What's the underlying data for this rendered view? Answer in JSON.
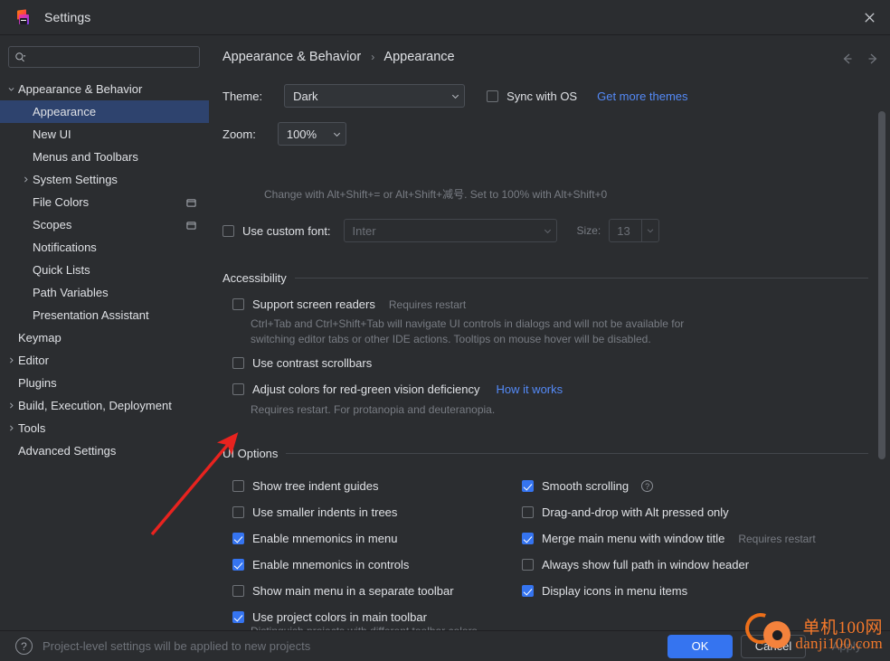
{
  "window": {
    "title": "Settings",
    "logo_icon": "jetbrains-logo-icon",
    "close_icon": "close-icon"
  },
  "sidebar": {
    "search": {
      "placeholder": "",
      "value": "",
      "icon": "search-icon"
    },
    "items": [
      {
        "label": "Appearance & Behavior",
        "level": 0,
        "twisty": "chevron-down-icon",
        "selected": false,
        "right_icon": ""
      },
      {
        "label": "Appearance",
        "level": 1,
        "twisty": "",
        "selected": true,
        "right_icon": ""
      },
      {
        "label": "New UI",
        "level": 1,
        "twisty": "",
        "selected": false,
        "right_icon": ""
      },
      {
        "label": "Menus and Toolbars",
        "level": 1,
        "twisty": "",
        "selected": false,
        "right_icon": ""
      },
      {
        "label": "System Settings",
        "level": 1,
        "twisty": "chevron-right-icon",
        "selected": false,
        "right_icon": ""
      },
      {
        "label": "File Colors",
        "level": 1,
        "twisty": "",
        "selected": false,
        "right_icon": "project-scope-icon"
      },
      {
        "label": "Scopes",
        "level": 1,
        "twisty": "",
        "selected": false,
        "right_icon": "project-scope-icon"
      },
      {
        "label": "Notifications",
        "level": 1,
        "twisty": "",
        "selected": false,
        "right_icon": ""
      },
      {
        "label": "Quick Lists",
        "level": 1,
        "twisty": "",
        "selected": false,
        "right_icon": ""
      },
      {
        "label": "Path Variables",
        "level": 1,
        "twisty": "",
        "selected": false,
        "right_icon": ""
      },
      {
        "label": "Presentation Assistant",
        "level": 1,
        "twisty": "",
        "selected": false,
        "right_icon": ""
      },
      {
        "label": "Keymap",
        "level": 0,
        "twisty": "",
        "selected": false,
        "right_icon": ""
      },
      {
        "label": "Editor",
        "level": 0,
        "twisty": "chevron-right-icon",
        "selected": false,
        "right_icon": ""
      },
      {
        "label": "Plugins",
        "level": 0,
        "twisty": "",
        "selected": false,
        "right_icon": ""
      },
      {
        "label": "Build, Execution, Deployment",
        "level": 0,
        "twisty": "chevron-right-icon",
        "selected": false,
        "right_icon": ""
      },
      {
        "label": "Tools",
        "level": 0,
        "twisty": "chevron-right-icon",
        "selected": false,
        "right_icon": ""
      },
      {
        "label": "Advanced Settings",
        "level": 0,
        "twisty": "",
        "selected": false,
        "right_icon": ""
      }
    ]
  },
  "breadcrumb": {
    "root": "Appearance & Behavior",
    "separator": "›",
    "current": "Appearance"
  },
  "nav": {
    "back_icon": "arrow-left-icon",
    "forward_icon": "arrow-right-icon"
  },
  "appearance": {
    "theme_label": "Theme:",
    "theme_value": "Dark",
    "sync_with_os_label": "Sync with OS",
    "sync_with_os_checked": false,
    "get_more_themes_label": "Get more themes",
    "zoom_label": "Zoom:",
    "zoom_value": "100%",
    "zoom_hint": "Change with Alt+Shift+= or Alt+Shift+减号. Set to 100% with Alt+Shift+0",
    "custom_font_label": "Use custom font:",
    "custom_font_checked": false,
    "custom_font_value": "Inter",
    "size_label": "Size:",
    "size_value": "13"
  },
  "accessibility": {
    "title": "Accessibility",
    "items": [
      {
        "label": "Support screen readers",
        "checked": false,
        "note": "Requires restart",
        "description": "Ctrl+Tab and Ctrl+Shift+Tab will navigate UI controls in dialogs and will not be available for switching editor tabs or other IDE actions. Tooltips on mouse hover will be disabled."
      },
      {
        "label": "Use contrast scrollbars",
        "checked": false,
        "note": "",
        "description": ""
      },
      {
        "label": "Adjust colors for red-green vision deficiency",
        "checked": false,
        "note": "",
        "link": "How it works",
        "description": "Requires restart. For protanopia and deuteranopia."
      }
    ]
  },
  "ui_options": {
    "title": "UI Options",
    "left_column": [
      {
        "label": "Show tree indent guides",
        "checked": false
      },
      {
        "label": "Use smaller indents in trees",
        "checked": false
      },
      {
        "label": "Enable mnemonics in menu",
        "checked": true
      },
      {
        "label": "Enable mnemonics in controls",
        "checked": true
      },
      {
        "label": "Show main menu in a separate toolbar",
        "checked": false
      },
      {
        "label": "Use project colors in main toolbar",
        "checked": true
      }
    ],
    "left_description": "Distinguish projects with different toolbar colors at a glance. Only for new UI.",
    "right_column": [
      {
        "label": "Smooth scrolling",
        "checked": true,
        "note": "",
        "help_icon": "help-circle-icon"
      },
      {
        "label": "Drag-and-drop with Alt pressed only",
        "checked": false,
        "note": ""
      },
      {
        "label": "Merge main menu with window title",
        "checked": true,
        "note": "Requires restart"
      },
      {
        "label": "Always show full path in window header",
        "checked": false,
        "note": ""
      },
      {
        "label": "Display icons in menu items",
        "checked": true,
        "note": ""
      }
    ]
  },
  "footer": {
    "help_icon": "help-circle-icon",
    "note": "Project-level settings will be applied to new projects",
    "ok_label": "OK",
    "cancel_label": "Cancel",
    "apply_label": "Apply"
  },
  "annotation": {
    "arrow_color": "#e8231f",
    "arrow_icon": "red-arrow-pointer"
  },
  "watermark": {
    "line1": "单机100网",
    "line2": "danji100.com",
    "color": "#f4792b",
    "logo_icon": "watermark-ring-icon"
  },
  "colors": {
    "background": "#2b2d30",
    "selection": "#2e436e",
    "accent": "#3574f0",
    "link": "#548af7",
    "muted_text": "#787c83"
  }
}
